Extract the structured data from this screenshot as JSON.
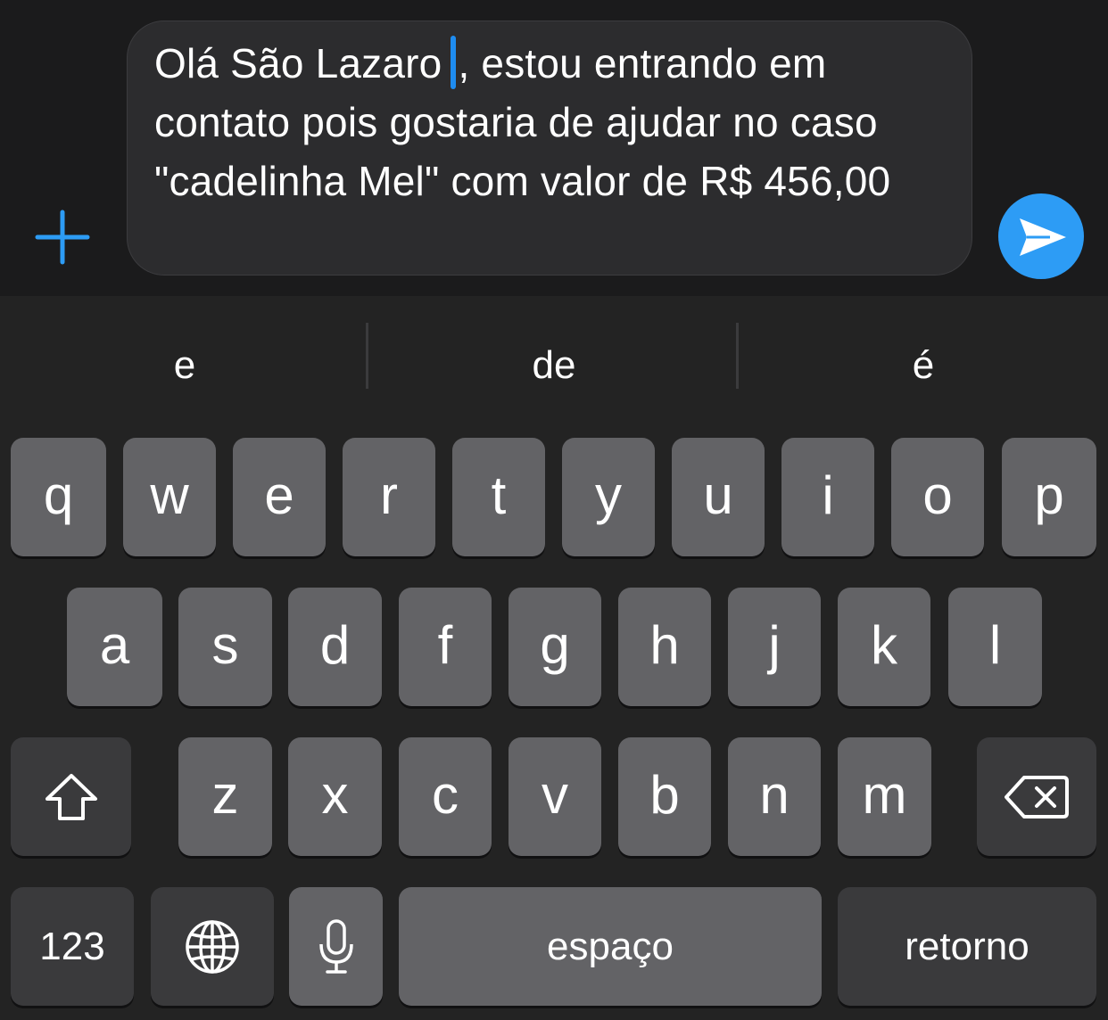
{
  "composer": {
    "message_before_cursor": "Olá São Lazaro",
    "message_after_cursor": ", estou entrando em contato pois gostaria de ajudar no caso \"cadelinha Mel\" com valor de R$ 456,00",
    "accent_color": "#2d9cf5",
    "plus_icon": "plus-icon",
    "send_icon": "send-arrow-icon"
  },
  "suggestions": [
    "e",
    "de",
    "é"
  ],
  "keyboard": {
    "row1": [
      "q",
      "w",
      "e",
      "r",
      "t",
      "y",
      "u",
      "i",
      "o",
      "p"
    ],
    "row2": [
      "a",
      "s",
      "d",
      "f",
      "g",
      "h",
      "j",
      "k",
      "l"
    ],
    "row3": [
      "z",
      "x",
      "c",
      "v",
      "b",
      "n",
      "m"
    ],
    "shift_icon": "shift-icon",
    "backspace_icon": "backspace-icon",
    "numbers_label": "123",
    "globe_icon": "globe-icon",
    "mic_icon": "microphone-icon",
    "space_label": "espaço",
    "return_label": "retorno"
  }
}
